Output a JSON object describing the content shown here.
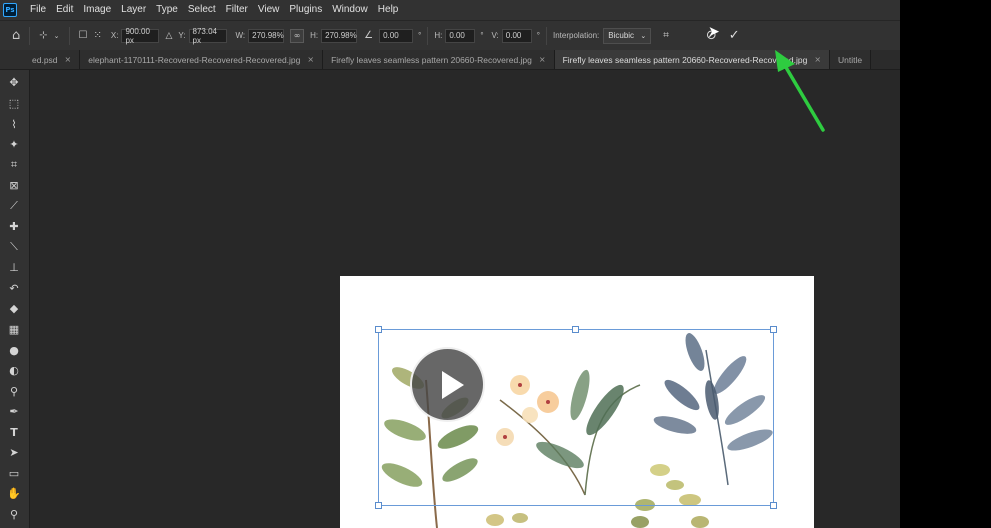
{
  "app": {
    "logo": "Ps"
  },
  "menu": [
    "File",
    "Edit",
    "Image",
    "Layer",
    "Type",
    "Select",
    "Filter",
    "View",
    "Plugins",
    "Window",
    "Help"
  ],
  "options": {
    "x_label": "X:",
    "x_value": "900.00 px",
    "y_label": "Y:",
    "y_value": "873.04 px",
    "w_label": "W:",
    "w_value": "270.98%",
    "h_label": "H:",
    "h_value": "270.98%",
    "angle_value": "0.00",
    "angle_unit": "°",
    "skew_h_label": "H:",
    "skew_h_value": "0.00",
    "skew_v_label": "V:",
    "skew_v_value": "0.00",
    "interp_label": "Interpolation:",
    "interp_value": "Bicubic"
  },
  "tabs": [
    {
      "label": "ed.psd"
    },
    {
      "label": "elephant-1170111-Recovered-Recovered-Recovered.jpg"
    },
    {
      "label": "Firefly leaves seamless pattern 20660-Recovered.jpg"
    },
    {
      "label": "Firefly leaves seamless pattern 20660-Recovered-Recovered.jpg"
    },
    {
      "label": "Untitle"
    }
  ],
  "tools": [
    "move-tool",
    "marquee-tool",
    "lasso-tool",
    "magic-wand-tool",
    "crop-tool",
    "frame-tool",
    "eyedropper-tool",
    "healing-brush-tool",
    "brush-tool",
    "clone-stamp-tool",
    "history-brush-tool",
    "eraser-tool",
    "gradient-tool",
    "blur-tool",
    "dodge-tool",
    "sponge-tool",
    "pen-tool",
    "type-tool",
    "path-selection-tool",
    "rectangle-tool",
    "hand-tool",
    "zoom-tool"
  ],
  "colors": {
    "arrow": "#2ecc40",
    "bbox": "#6a9bd8",
    "panel": "#323232",
    "canvas": "#282828"
  }
}
